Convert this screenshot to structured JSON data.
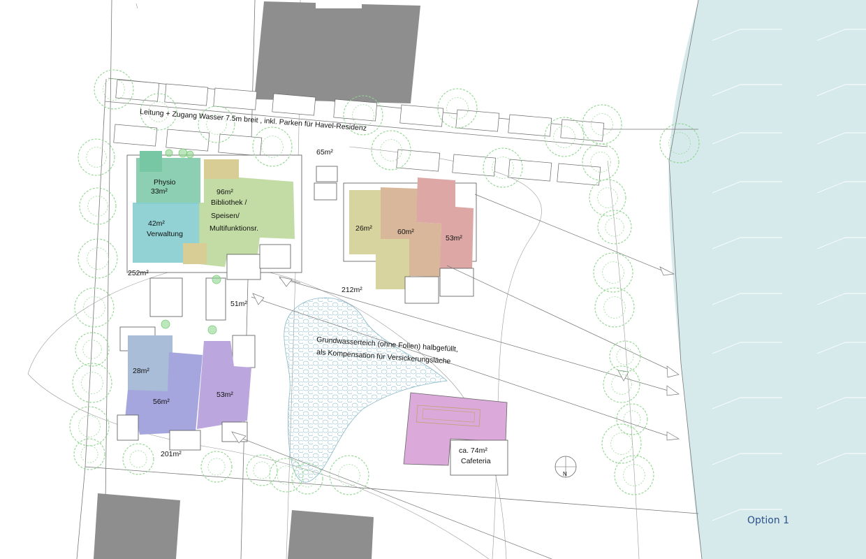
{
  "labels": {
    "road_access": "Leitung + Zugang Wasser 7.5m breit , inkl. Parken für Havel-Residenz",
    "area_65": "65m²",
    "physio_name": "Physio",
    "physio_area": "33m²",
    "verwaltung_area": "42m²",
    "verwaltung_name": "Verwaltung",
    "bib_area": "96m²",
    "bib_line1": "Bibliothek /",
    "bib_line2": "Speisen/",
    "bib_line3": "Multifunktionsr.",
    "total_252": "252m²",
    "area_51": "51m²",
    "area_26": "26m²",
    "area_60": "60m²",
    "area_53_top": "53m²",
    "total_212": "212m²",
    "pond_line1": "Grundwasserteich (ohne Folien) halbgefüllt,",
    "pond_line2": "als Kompensation für Versickerungsläche",
    "area_28": "28m²",
    "area_56": "56m²",
    "area_53_bottom": "53m²",
    "total_201": "201m²",
    "cafe_area": "ca. 74m²",
    "cafe_name": "Cafeteria",
    "north": "N",
    "option": "Option 1"
  },
  "colors": {
    "water": "#d6eaeb",
    "building_grey": "#8e8e8e",
    "tree": "#8fd68f",
    "physio": "#78c7a4",
    "verwaltung": "#86cdd0",
    "bibliothek": "#bcd89b",
    "annex_tan": "#d8cd95",
    "room_26": "#d8d4a0",
    "room_60": "#d8b79b",
    "room_53_top": "#dda7a6",
    "room_28": "#a9bcd8",
    "room_56": "#a6a6de",
    "room_53_bottom": "#bba6dd",
    "cafeteria": "#dba9da",
    "option_text": "#2a4f8a"
  }
}
